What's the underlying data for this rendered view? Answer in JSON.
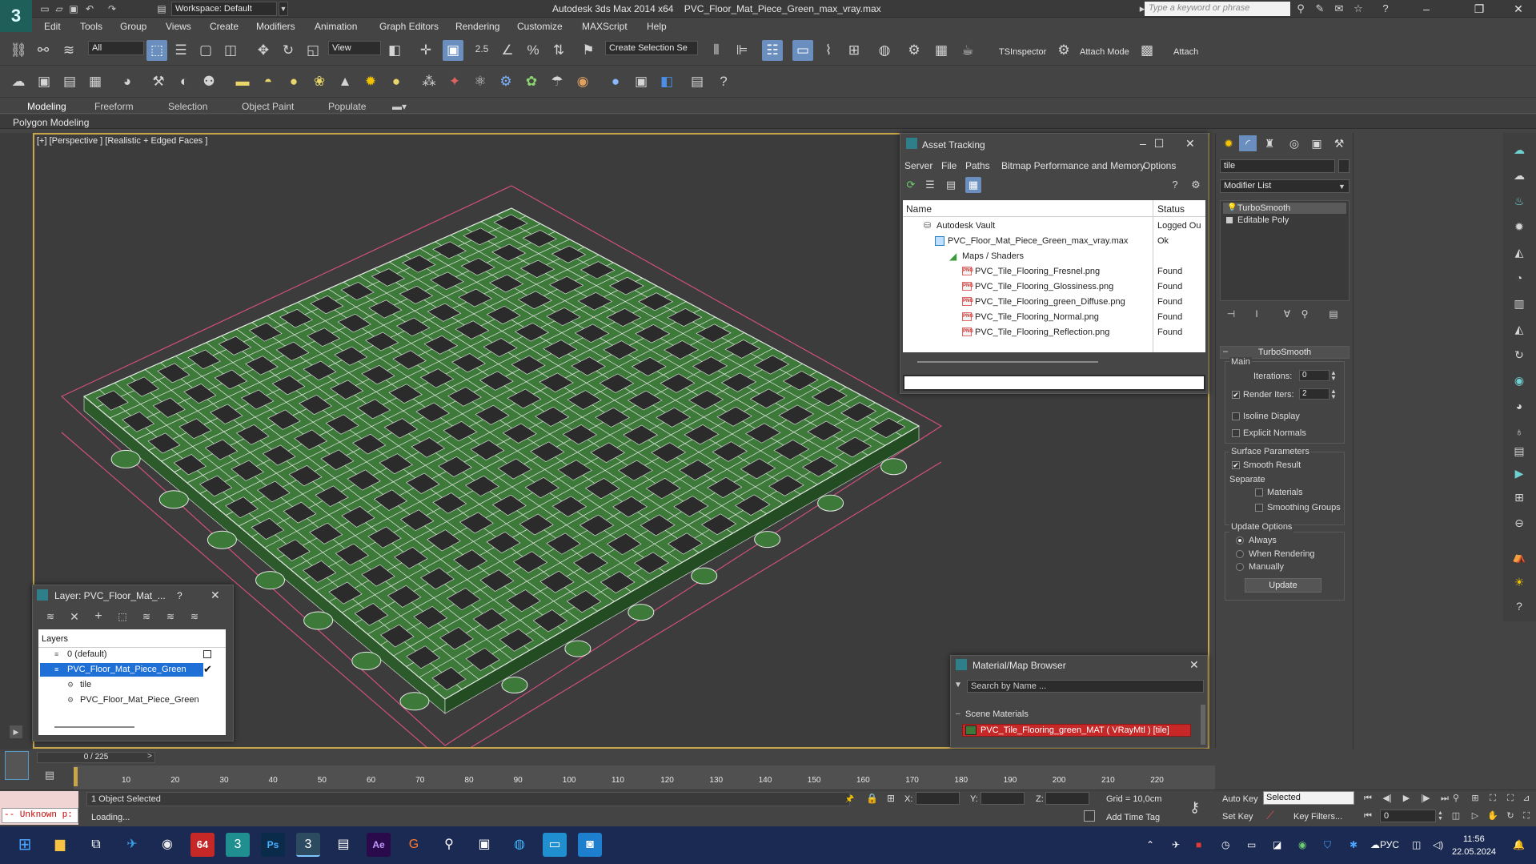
{
  "titlebar": {
    "workspace": "Workspace: Default",
    "title_app": "Autodesk 3ds Max 2014 x64",
    "title_file": "PVC_Floor_Mat_Piece_Green_max_vray.max",
    "search_placeholder": "Type a keyword or phrase"
  },
  "menu": [
    "Edit",
    "Tools",
    "Group",
    "Views",
    "Create",
    "Modifiers",
    "Animation",
    "Graph Editors",
    "Rendering",
    "Customize",
    "MAXScript",
    "Help"
  ],
  "toolbar": {
    "selection_filter": "All",
    "ref_coord": "View",
    "snap_angle": "2.5",
    "named_selection": "Create Selection Se",
    "tsinspector": "TSInspector",
    "attach_mode": "Attach Mode",
    "attach": "Attach"
  },
  "ribbon": {
    "tabs": [
      "Modeling",
      "Freeform",
      "Selection",
      "Object Paint",
      "Populate"
    ],
    "active_tab": "Modeling",
    "sub_label": "Polygon Modeling"
  },
  "viewport": {
    "label": "[+] [Perspective ] [Realistic + Edged Faces ]",
    "mesh_color": "#3d7a3a",
    "wire_color": "#e8e8e8",
    "bbox_color": "#d0507a"
  },
  "asset_tracking": {
    "title": "Asset Tracking",
    "menu": [
      "Server",
      "File",
      "Paths",
      "Bitmap Performance and Memory",
      "Options"
    ],
    "col_name": "Name",
    "col_status": "Status",
    "rows": [
      {
        "name": "Autodesk Vault",
        "status": "Logged Ou",
        "indent": 1
      },
      {
        "name": "PVC_Floor_Mat_Piece_Green_max_vray.max",
        "status": "Ok",
        "indent": 2
      },
      {
        "name": "Maps / Shaders",
        "status": "",
        "indent": 3
      },
      {
        "name": "PVC_Tile_Flooring_Fresnel.png",
        "status": "Found",
        "indent": 4
      },
      {
        "name": "PVC_Tile_Flooring_Glossiness.png",
        "status": "Found",
        "indent": 4
      },
      {
        "name": "PVC_Tile_Flooring_green_Diffuse.png",
        "status": "Found",
        "indent": 4
      },
      {
        "name": "PVC_Tile_Flooring_Normal.png",
        "status": "Found",
        "indent": 4
      },
      {
        "name": "PVC_Tile_Flooring_Reflection.png",
        "status": "Found",
        "indent": 4
      }
    ]
  },
  "layer_window": {
    "title": "Layer: PVC_Floor_Mat_...",
    "help": "?",
    "header": "Layers",
    "rows": [
      "0 (default)",
      "PVC_Floor_Mat_Piece_Green",
      "tile",
      "PVC_Floor_Mat_Piece_Green"
    ]
  },
  "material_browser": {
    "title": "Material/Map Browser",
    "search_placeholder": "Search by Name ...",
    "group": "Scene Materials",
    "item": "PVC_Tile_Flooring_green_MAT ( VRayMtl ) [tile]"
  },
  "command_panel": {
    "object_name": "tile",
    "modifier_list": "Modifier List",
    "stack": [
      "TurboSmooth",
      "Editable Poly"
    ],
    "rollout": "TurboSmooth",
    "main": "Main",
    "iterations_label": "Iterations:",
    "iterations": "0",
    "render_iters_label": "Render Iters:",
    "render_iters": "2",
    "isoline": "Isoline Display",
    "explicit_normals": "Explicit Normals",
    "surface_params": "Surface Parameters",
    "smooth_result": "Smooth Result",
    "separate": "Separate",
    "materials": "Materials",
    "smoothing_groups": "Smoothing Groups",
    "update_options": "Update Options",
    "always": "Always",
    "when_rendering": "When Rendering",
    "manually": "Manually",
    "update": "Update"
  },
  "timeline": {
    "slider": "0 / 225",
    "ticks": [
      "10",
      "20",
      "30",
      "40",
      "50",
      "60",
      "70",
      "80",
      "90",
      "100",
      "110",
      "120",
      "130",
      "140",
      "150",
      "160",
      "170",
      "180",
      "190",
      "200",
      "210",
      "220"
    ]
  },
  "status": {
    "maxscript": "-- Unknown p:",
    "selected": "1 Object Selected",
    "loading": "Loading...",
    "x": "X:",
    "y": "Y:",
    "z": "Z:",
    "grid": "Grid = 10,0cm",
    "add_time_tag": "Add Time Tag",
    "auto_key": "Auto Key",
    "set_key": "Set Key",
    "key_selected": "Selected",
    "key_filters": "Key Filters...",
    "frame": "0"
  },
  "taskbar": {
    "lang": "РУС",
    "time": "11:56",
    "date": "22.05.2024",
    "badge": "64"
  }
}
